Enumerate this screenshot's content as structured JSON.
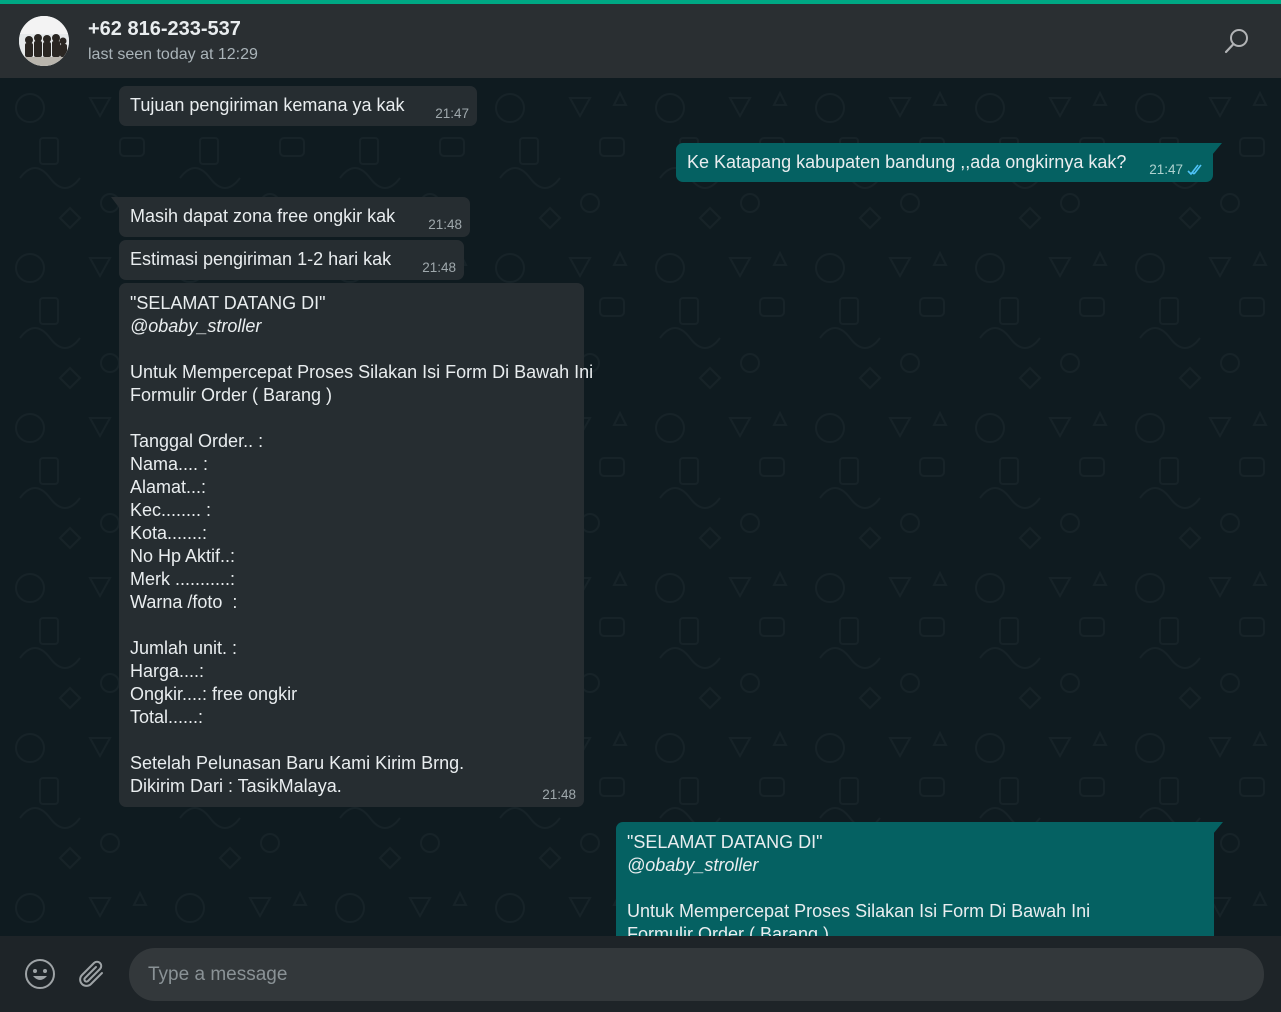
{
  "header": {
    "contact_name": "+62 816-233-537",
    "last_seen": "last seen today at 12:29",
    "avatar_icon": "group-photo-avatar",
    "search_icon": "search-icon"
  },
  "messages": [
    {
      "direction": "in",
      "text": "Tujuan pengiriman kemana ya kak",
      "time": "21:47"
    },
    {
      "direction": "out",
      "text": "Ke Katapang kabupaten bandung ,,ada ongkirnya kak?",
      "time": "21:47",
      "status": "read"
    },
    {
      "direction": "in",
      "text": "Masih dapat zona free ongkir kak",
      "time": "21:48"
    },
    {
      "direction": "in",
      "text": "Estimasi pengiriman 1-2 hari kak",
      "time": "21:48"
    },
    {
      "direction": "in",
      "time": "21:48",
      "lines": [
        "\"SELAMAT DATANG DI\"",
        "@obaby_stroller",
        "",
        "Untuk Mempercepat Proses Silakan Isi Form Di Bawah Ini",
        "Formulir Order ( Barang )",
        "",
        "Tanggal Order.. :",
        "Nama.... :",
        "Alamat...:",
        "Kec........ :",
        "Kota.......:",
        "No Hp Aktif..:",
        "Merk ...........:",
        "Warna /foto  :",
        "",
        "Jumlah unit. :",
        "Harga....:",
        "Ongkir....: free ongkir",
        "Total......:",
        "",
        "Setelah Pelunasan Baru Kami Kirim Brng.",
        "Dikirim Dari : TasikMalaya."
      ]
    },
    {
      "direction": "out",
      "lines": [
        "\"SELAMAT DATANG DI\"",
        "@obaby_stroller",
        "",
        "Untuk Mempercepat Proses Silakan Isi Form Di Bawah Ini",
        "Formulir Order ( Barang )"
      ]
    }
  ],
  "composer": {
    "placeholder": "Type a message",
    "emoji_icon": "smiley-icon",
    "attach_icon": "paperclip-icon"
  },
  "colors": {
    "accent": "#00a884",
    "incoming_bubble": "#262d31",
    "outgoing_bubble": "#056162",
    "read_ticks": "#4fc3f7"
  }
}
